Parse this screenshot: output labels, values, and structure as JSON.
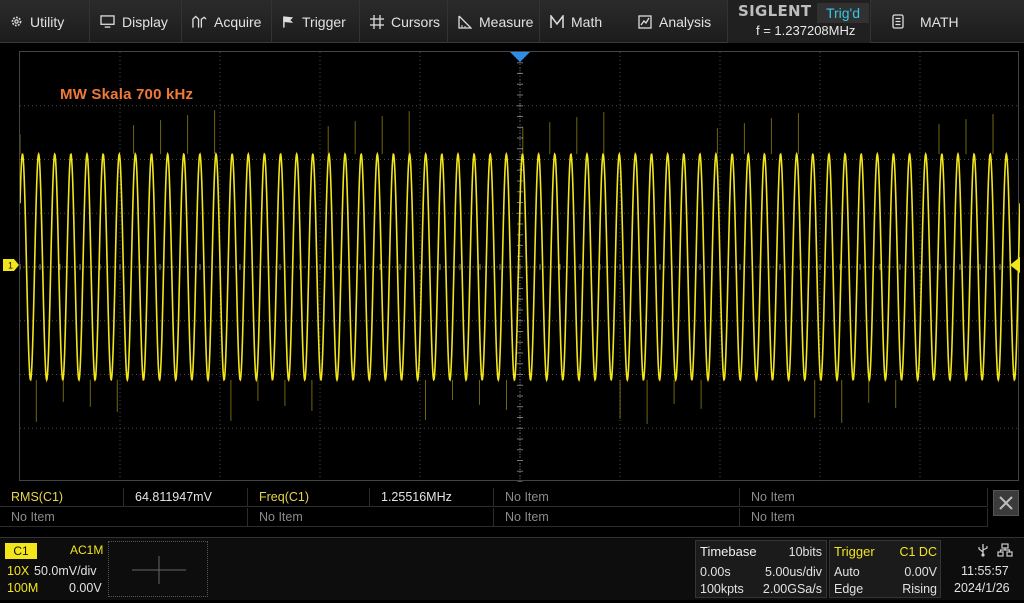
{
  "menu": {
    "items": [
      {
        "label": "Utility",
        "icon": "gear-icon"
      },
      {
        "label": "Display",
        "icon": "monitor-icon"
      },
      {
        "label": "Acquire",
        "icon": "acquire-icon"
      },
      {
        "label": "Trigger",
        "icon": "trigger-flag-icon"
      },
      {
        "label": "Cursors",
        "icon": "cursors-crosshair-icon"
      },
      {
        "label": "Measure",
        "icon": "measure-ruler-icon"
      },
      {
        "label": "Math",
        "icon": "math-icon"
      },
      {
        "label": "Analysis",
        "icon": "analysis-icon"
      }
    ],
    "brand": "SIGLENT",
    "trigger_status": "Trig'd",
    "frequency": "f = 1.237208MHz",
    "math_label": "MATH"
  },
  "display": {
    "annotation": "MW Skala 700 kHz",
    "ch1_marker": "1",
    "colors": {
      "trace": "#f3e51c",
      "annotation": "#f07a37",
      "status_cyan": "#36c9e6",
      "trigger_label": "#f3e51c"
    },
    "waveform": {
      "cycles": 62,
      "amplitude_divs": 2.1,
      "center_divs": 0
    }
  },
  "measurements": {
    "rows": [
      [
        {
          "label": "RMS(C1)",
          "value": "64.811947mV"
        },
        {
          "label": "Freq(C1)",
          "value": "1.25516MHz"
        },
        {
          "label": "No Item",
          "value": ""
        },
        {
          "label": "No Item",
          "value": ""
        }
      ],
      [
        {
          "label": "No Item",
          "value": ""
        },
        {
          "label": "No Item",
          "value": ""
        },
        {
          "label": "No Item",
          "value": ""
        },
        {
          "label": "No Item",
          "value": ""
        }
      ]
    ]
  },
  "status": {
    "ch1": {
      "badge": "C1",
      "coupling": "AC1M",
      "probe": "10X",
      "scale": "50.0mV/div",
      "bandwidth": "100M",
      "offset": "0.00V"
    },
    "timebase": {
      "title": "Timebase",
      "bits": "10bits",
      "delay": "0.00s",
      "scale": "5.00us/div",
      "memory": "100kpts",
      "sample_rate": "2.00GSa/s"
    },
    "trigger": {
      "title": "Trigger",
      "source": "C1 DC",
      "mode": "Auto",
      "level": "0.00V",
      "type": "Edge",
      "slope": "Rising"
    },
    "clock": {
      "time": "11:55:57",
      "date": "2024/1/26"
    }
  }
}
